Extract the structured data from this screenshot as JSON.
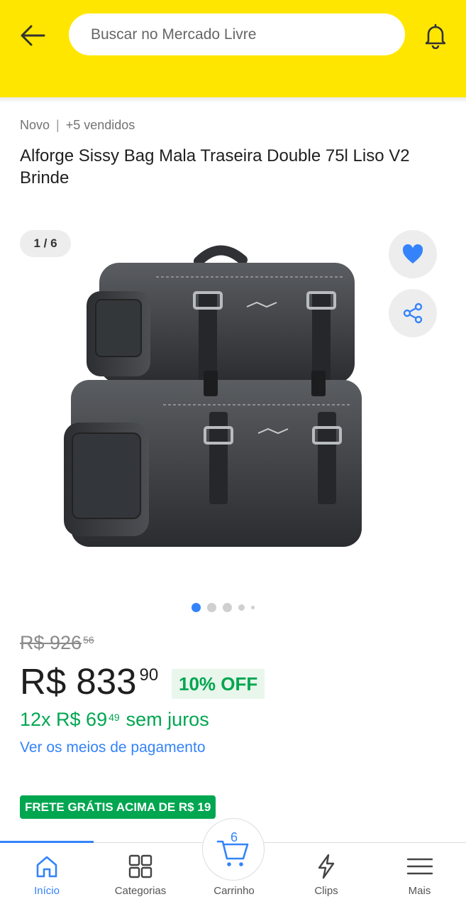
{
  "header": {
    "search_placeholder": "Buscar no Mercado Livre",
    "back_icon": "arrow-left-icon",
    "bell_icon": "bell-icon",
    "background": "#ffe600"
  },
  "product": {
    "condition": "Novo",
    "separator": "|",
    "sold": "+5 vendidos",
    "title": "Alforge Sissy Bag Mala Traseira Double 75l Liso V2 Brinde"
  },
  "gallery": {
    "counter": "1 / 6",
    "total_images": 6,
    "current_image": 1
  },
  "pricing": {
    "old_price": "R$ 926",
    "old_price_cents": "56",
    "price": "R$ 833",
    "price_cents": "90",
    "discount": "10% OFF",
    "installments": "12x R$ 69",
    "installments_cents": "49",
    "installments_rest": "sem juros",
    "payment_link": "Ver os meios de pagamento",
    "free_shipping": "FRETE GRÁTIS ACIMA DE R$ 19"
  },
  "bottom_nav": {
    "items": [
      {
        "label": "Início",
        "icon": "home-icon",
        "active": true
      },
      {
        "label": "Categorias",
        "icon": "grid-icon",
        "active": false
      },
      {
        "label": "Carrinho",
        "icon": "cart-icon",
        "active": false,
        "badge": "6"
      },
      {
        "label": "Clips",
        "icon": "lightning-icon",
        "active": false
      },
      {
        "label": "Mais",
        "icon": "menu-icon",
        "active": false
      }
    ]
  },
  "colors": {
    "accent": "#3483fa",
    "green": "#00a650",
    "header_yellow": "#ffe600"
  }
}
